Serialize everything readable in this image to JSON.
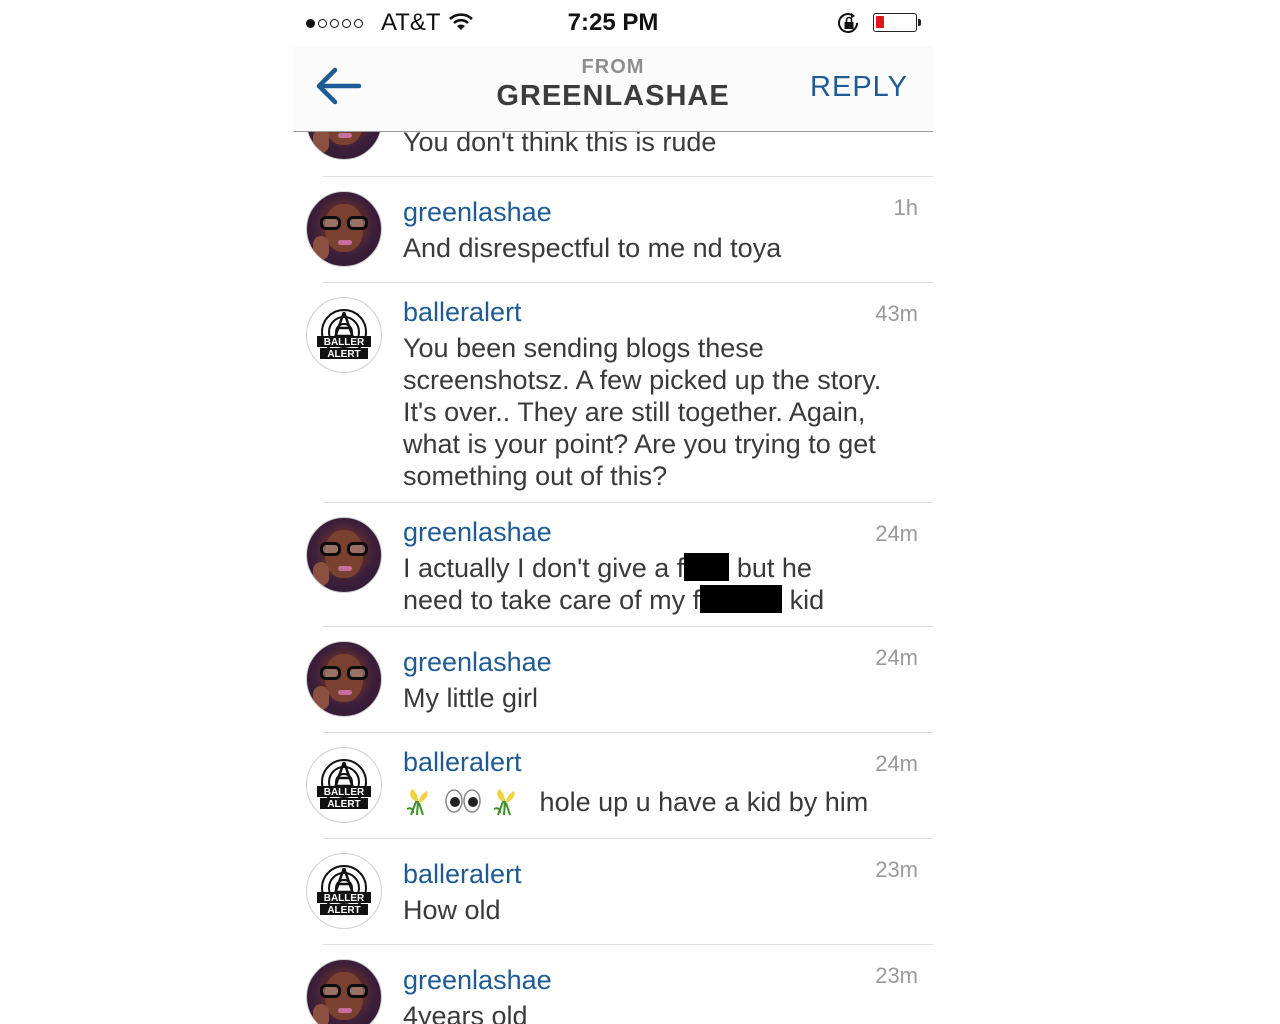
{
  "status_bar": {
    "carrier": "AT&T",
    "time": "7:25 PM",
    "signal_bars_filled": 1,
    "signal_bars_total": 5,
    "battery_level": 0.2,
    "battery_color": "#e0161b"
  },
  "nav": {
    "from_label": "FROM",
    "title": "GREENLASHAE",
    "reply_label": "REPLY",
    "accent_color": "#1e5b96"
  },
  "messages": [
    {
      "username": "",
      "time": "",
      "text": "You don't think this is rude",
      "avatar": "person-avatar"
    },
    {
      "username": "greenlashae",
      "time": "1h",
      "text": "And disrespectful to me nd toya",
      "avatar": "person-avatar"
    },
    {
      "username": "balleralert",
      "time": "43m",
      "text": "You been sending blogs  these screenshotsz. A few picked up the story. It's over.. They are still together. Again, what is your point? Are you trying to get something out of this?",
      "avatar": "baller-alert-logo"
    },
    {
      "username": "greenlashae",
      "time": "24m",
      "text_line1_start": "I actually I don't give a f",
      "text_line1_end": " but he",
      "text_line2_start": "need to take care of my f",
      "text_line2_end": " kid",
      "avatar": "person-avatar"
    },
    {
      "username": "greenlashae",
      "time": "24m",
      "text": "My little girl",
      "avatar": "person-avatar"
    },
    {
      "username": "balleralert",
      "time": "24m",
      "text": "hole up u have a kid by him",
      "avatar": "baller-alert-logo",
      "emojis": [
        "flower-emoji",
        "eyes-emoji",
        "flower-emoji"
      ]
    },
    {
      "username": "balleralert",
      "time": "23m",
      "text": "How old",
      "avatar": "baller-alert-logo"
    },
    {
      "username": "greenlashae",
      "time": "23m",
      "text": "4years old",
      "avatar": "person-avatar"
    }
  ],
  "logo_text": {
    "line1": "BALLER",
    "line2": "ALERT"
  }
}
